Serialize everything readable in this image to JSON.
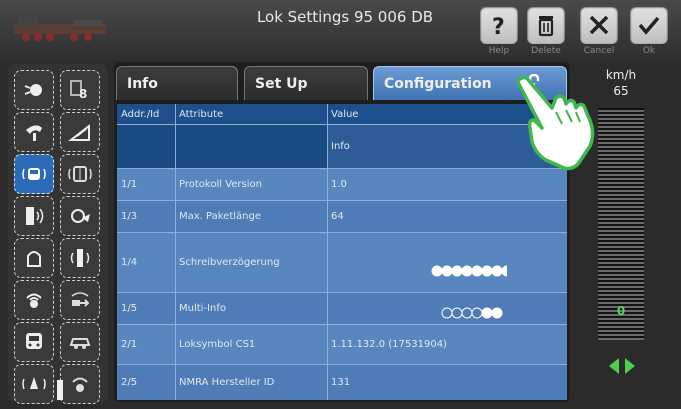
{
  "header": {
    "title": "Lok Settings 95 006 DB",
    "buttons": [
      {
        "label": "Help",
        "icon": "help-icon"
      },
      {
        "label": "Delete",
        "icon": "trash-icon"
      },
      {
        "label": "Cancel",
        "icon": "close-icon"
      },
      {
        "label": "Ok",
        "icon": "check-icon"
      }
    ]
  },
  "tabs": [
    {
      "label": "Info"
    },
    {
      "label": "Set Up"
    },
    {
      "label": "Configuration",
      "icon": "unlock-icon",
      "active": true
    }
  ],
  "table": {
    "headers": [
      "Addr./Id",
      "Attribute",
      "Value"
    ],
    "subheader_value": "Info",
    "rows": [
      {
        "addr": "1/1",
        "attr": "Protokoll Version",
        "value": "1.0"
      },
      {
        "addr": "1/3",
        "attr": "Max. Paketlänge",
        "value": "64"
      },
      {
        "addr": "1/4",
        "attr": "Schreibverzögerung",
        "value": ""
      },
      {
        "addr": "1/5",
        "attr": "Multi-Info",
        "value": ""
      },
      {
        "addr": "2/1",
        "attr": "Loksymbol CS1",
        "value": "1.11.132.0 (17531904)"
      },
      {
        "addr": "2/5",
        "attr": "NMRA Hersteller ID",
        "value": "131"
      }
    ]
  },
  "speed": {
    "unit": "km/h",
    "value": "65",
    "meter_label": "0",
    "fill_fraction": 0.0
  },
  "leftbar": {
    "digit_button_text": "8"
  },
  "colors": {
    "accent": "#3f73b2",
    "table_bg": "#174476",
    "row_alt": "#5a86c0",
    "direction": "#4dd04d"
  }
}
